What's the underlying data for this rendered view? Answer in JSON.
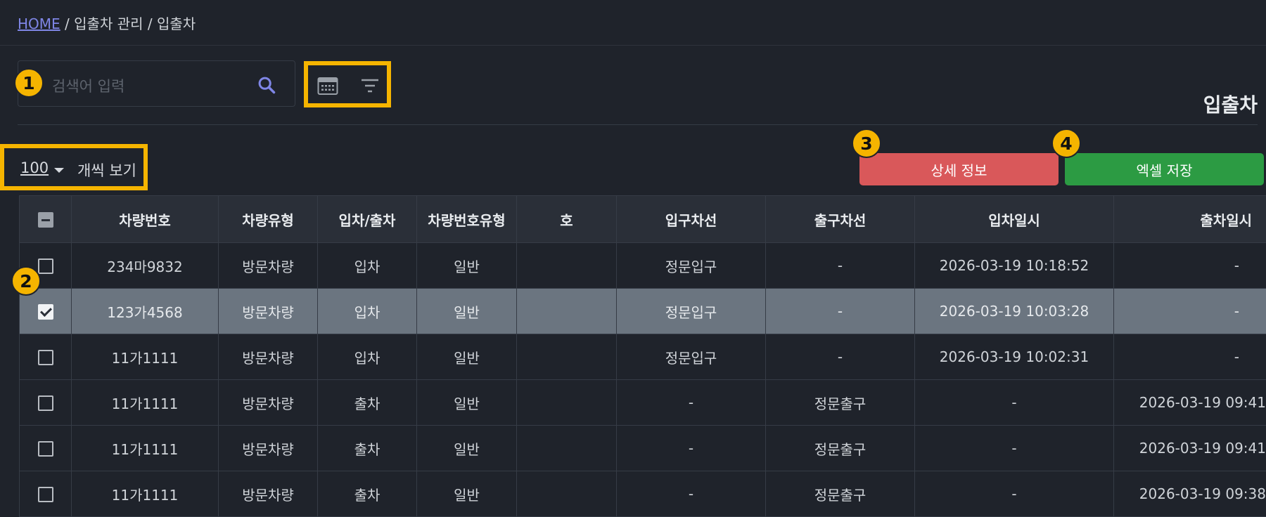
{
  "breadcrumb": {
    "home": "HOME",
    "sep1": "/",
    "section": "입출차 관리",
    "sep2": "/",
    "current": "입출차"
  },
  "search": {
    "placeholder": "검색어 입력"
  },
  "page_title": "입출차",
  "per_page": {
    "value": "100",
    "label": "개씩 보기"
  },
  "buttons": {
    "detail": "상세 정보",
    "excel": "엑셀 저장"
  },
  "badges": [
    "1",
    "2",
    "3",
    "4"
  ],
  "colors": {
    "accent_highlight": "#f5b400",
    "detail_button": "#d9585a",
    "excel_button": "#2c9b43",
    "link": "#7f86e6",
    "selected_row": "#6b7580"
  },
  "table": {
    "headers": [
      "차량번호",
      "차량유형",
      "입차/출차",
      "차량번호유형",
      "호",
      "입구차선",
      "출구차선",
      "입차일시",
      "출차일시"
    ],
    "rows": [
      {
        "checked": false,
        "cells": [
          "234마9832",
          "방문차량",
          "입차",
          "일반",
          "",
          "정문입구",
          "-",
          "2026-03-19 10:18:52",
          "-"
        ]
      },
      {
        "checked": true,
        "cells": [
          "123가4568",
          "방문차량",
          "입차",
          "일반",
          "",
          "정문입구",
          "-",
          "2026-03-19 10:03:28",
          "-"
        ]
      },
      {
        "checked": false,
        "cells": [
          "11가1111",
          "방문차량",
          "입차",
          "일반",
          "",
          "정문입구",
          "-",
          "2026-03-19 10:02:31",
          "-"
        ]
      },
      {
        "checked": false,
        "cells": [
          "11가1111",
          "방문차량",
          "출차",
          "일반",
          "",
          "-",
          "정문출구",
          "-",
          "2026-03-19 09:41"
        ]
      },
      {
        "checked": false,
        "cells": [
          "11가1111",
          "방문차량",
          "출차",
          "일반",
          "",
          "-",
          "정문출구",
          "-",
          "2026-03-19 09:41"
        ]
      },
      {
        "checked": false,
        "cells": [
          "11가1111",
          "방문차량",
          "출차",
          "일반",
          "",
          "-",
          "정문출구",
          "-",
          "2026-03-19 09:38"
        ]
      }
    ]
  }
}
